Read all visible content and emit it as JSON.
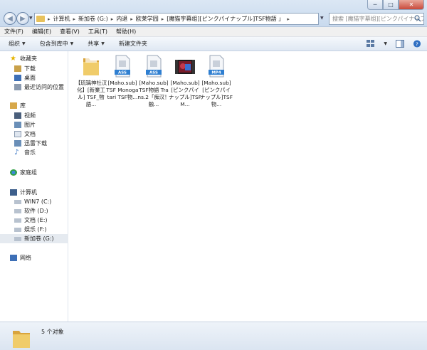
{
  "window": {
    "controls": [
      "─",
      "□",
      "✕"
    ]
  },
  "address": {
    "segments": [
      "计算机",
      "新加卷 (G:)",
      "内退",
      "欧莱学园",
      "[魔猫字幕组][ピンクパイナップル]TSF物語 」"
    ],
    "search_placeholder": "搜索 [魔猫字幕组][ピンクパイナップ..."
  },
  "menubar": {
    "items": [
      "文件(F)",
      "编辑(E)",
      "查看(V)",
      "工具(T)",
      "帮助(H)"
    ]
  },
  "toolbar": {
    "organize": "组织",
    "include": "包含到库中",
    "share": "共享",
    "new_folder": "新建文件夹"
  },
  "sidebar": {
    "favorites": {
      "label": "收藏夹",
      "items": [
        "下载",
        "桌面",
        "最近访问的位置"
      ]
    },
    "libraries": {
      "label": "库",
      "items": [
        "视频",
        "图片",
        "文档",
        "迅雷下载",
        "音乐"
      ]
    },
    "homegroup": "家庭组",
    "computer": {
      "label": "计算机",
      "items": [
        "WIN7 (C:)",
        "软件 (D:)",
        "文档 (E:)",
        "娱乐 (F:)",
        "新加卷 (G:)"
      ]
    },
    "network": "网络"
  },
  "files": [
    {
      "type": "folder",
      "label": "【琉璃神社汉化】[新業工ル] TSF_物語..."
    },
    {
      "type": "ass",
      "badge": "ASS",
      "label": "[Maho.sub] TSF Monogatari TSF物..."
    },
    {
      "type": "ass",
      "badge": "ASS",
      "label": "[Maho.sub] TSF物語 Trans.2「痴汉！触..."
    },
    {
      "type": "video",
      "label": "[Maho.sub][ピンクパイナップル]TSF M..."
    },
    {
      "type": "mp4",
      "badge": "MP4",
      "label": "[Maho.sub][ピンクパイナップル]TSF物..."
    }
  ],
  "details": {
    "count": "5 个对象"
  },
  "colors": {
    "folder": "#e8c25c",
    "accent_blue": "#2f7fd1",
    "selection": "#e5eaf0"
  }
}
